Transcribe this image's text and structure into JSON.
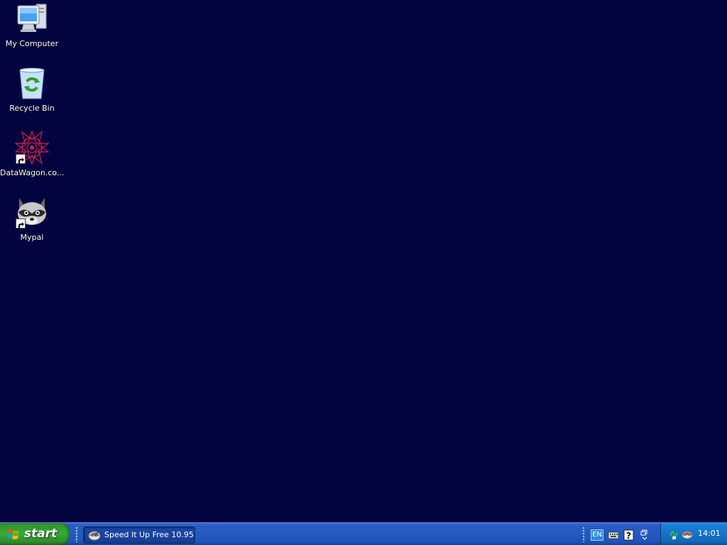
{
  "desktop": {
    "background_color": "#03033f",
    "icons": [
      {
        "label": "My Computer",
        "icon": "my-computer-icon",
        "shortcut": false
      },
      {
        "label": "Recycle Bin",
        "icon": "recycle-bin-icon",
        "shortcut": false
      },
      {
        "label": "DataWagon.co...",
        "icon": "datawagon-icon",
        "shortcut": true
      },
      {
        "label": "Mypal",
        "icon": "mypal-raccoon-icon",
        "shortcut": true
      }
    ]
  },
  "taskbar": {
    "start_label": "start",
    "tasks": [
      {
        "label": "Speed It Up Free 10.95",
        "icon": "speed-it-up-icon"
      }
    ],
    "language": "EN",
    "toolbar_icons": [
      "keyboard-icon",
      "help-icon",
      "restore-icon"
    ],
    "tray_icons": [
      "tray-recycle-icon",
      "tray-speed-it-up-icon"
    ],
    "clock": "14:01"
  }
}
